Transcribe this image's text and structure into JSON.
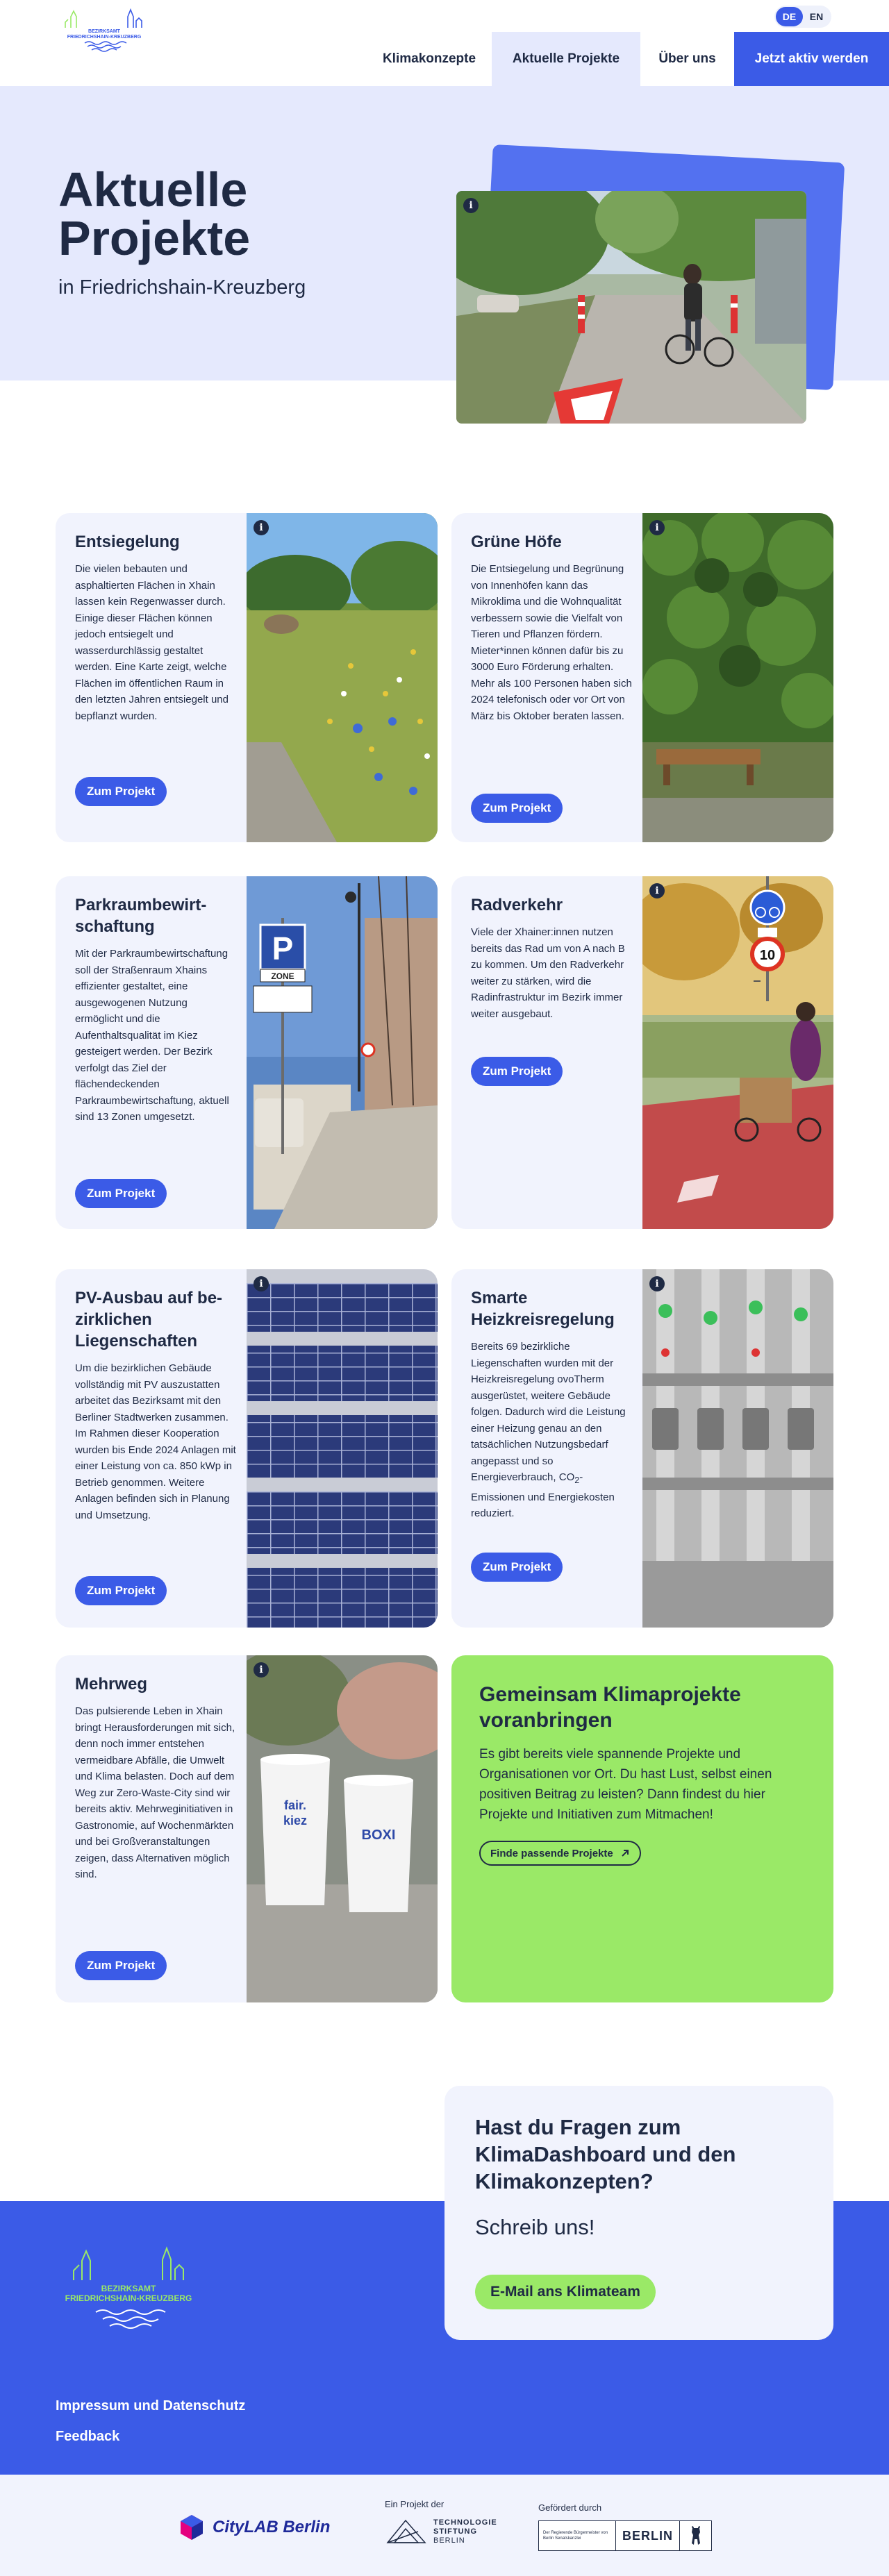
{
  "header": {
    "logo_line1": "BEZIRKSAMT",
    "logo_line2": "FRIEDRICHSHAIN-KREUZBERG",
    "lang": {
      "de": "DE",
      "en": "EN"
    },
    "nav": {
      "klimakonzepte": "Klimakonzepte",
      "aktuelle_projekte": "Aktuelle Projekte",
      "ueber_uns": "Über uns",
      "aktiv": "Jetzt aktiv werden"
    }
  },
  "hero": {
    "title_line1": "Aktuelle",
    "title_line2": "Projekte",
    "subtitle": "in Friedrichshain-Kreuzberg"
  },
  "info_glyph": "i",
  "projects": [
    {
      "title": "Entsiegelung",
      "description": "Die vielen bebauten und asphaltierten Flächen in Xhain lassen kein Regenwasser durch. Einige dieser Flächen können jedoch entsiegelt und wasserdurchlässig gestaltet werden. Eine Karte zeigt, welche Flächen im öffentlichen Raum in den letzten Jahren entsiegelt und bepflanzt wurden.",
      "button": "Zum Projekt"
    },
    {
      "title": "Grüne Höfe",
      "description": "Die Entsiegelung und Begrünung von Innenhöfen kann das Mikroklima und die Wohnqualität verbessern sowie die Vielfalt von Tieren und Pflanzen fördern. Mieter*innen können dafür bis zu 3000 Euro Förderung erhalten. Mehr als 100 Personen haben sich 2024 telefonisch oder vor Ort von März bis Oktober beraten lassen.",
      "button": "Zum Projekt"
    },
    {
      "title_line1": "Parkraumbewirt-",
      "title_line2": "schaftung",
      "description": "Mit der Parkraumbewirtschaftung soll der Straßenraum Xhains effizienter gestaltet, eine ausgewogenen Nutzung ermöglicht und die Aufenthaltsqualität im Kiez gesteigert werden. Der Bezirk verfolgt das Ziel der flächendeckenden Parkraumbewirtschaftung, aktuell sind 13 Zonen umgesetzt.",
      "button": "Zum Projekt",
      "sign_text": "ZONE"
    },
    {
      "title": "Radverkehr",
      "description": "Viele der Xhainer:innen nutzen bereits das Rad um von A nach B zu kommen. Um den Radverkehr weiter zu stärken, wird die Radinfrastruktur im Bezirk immer weiter ausgebaut.",
      "button": "Zum Projekt",
      "sign_number": "10"
    },
    {
      "title_line1": "PV-Ausbau auf be-",
      "title_line2": "zirklichen",
      "title_line3": "Liegenschaften",
      "description": "Um die bezirklichen Gebäude vollständig mit PV auszustatten arbeitet das Bezirksamt mit den Berliner Stadtwerken zusammen. Im Rahmen dieser Kooperation wurden bis Ende 2024 Anlagen mit einer Leistung von ca. 850 kWp in Betrieb genommen. Weitere Anlagen befinden sich in Planung und Umsetzung.",
      "button": "Zum Projekt"
    },
    {
      "title_line1": "Smarte",
      "title_line2": "Heizkreisregelung",
      "description_part1": "Bereits 69 bezirkliche Liegenschaften wurden mit der Heizkreisregelung ovoTherm ausgerüstet, weitere Gebäude folgen. Dadurch wird die Leistung einer Heizung genau an den tatsächlichen Nutzungsbedarf angepasst und so Energieverbrauch, CO",
      "description_sub": "2",
      "description_part2": "-Emissionen und Energiekosten reduziert.",
      "button": "Zum Projekt"
    },
    {
      "title": "Mehrweg",
      "description": "Das pulsierende Leben in Xhain bringt Herausforderungen mit sich, denn noch immer entstehen vermeidbare Abfälle, die Umwelt und Klima belasten. Doch auf dem Weg zur Zero-Waste-City sind wir bereits aktiv. Mehrweginitiativen in Gastronomie, auf Wochenmärkten und bei Großveranstaltungen zeigen, dass Alternativen möglich sind.",
      "button": "Zum Projekt",
      "cup1_line1": "fair.",
      "cup1_line2": "kiez",
      "cup2_text": "BOXI"
    }
  ],
  "cta": {
    "title": "Gemeinsam Klimaprojekte voranbringen",
    "text": "Es gibt bereits viele spannende Projekte und Organisationen vor Ort. Du hast Lust, selbst einen positiven Beitrag zu leisten? Dann findest du hier Projekte und Initiativen zum Mitmachen!",
    "button": "Finde passende Projekte"
  },
  "contact": {
    "title": "Hast du Fragen zum KlimaDashboard und den Klimakonzepten?",
    "subtitle": "Schreib uns!",
    "button": "E-Mail ans Klimateam"
  },
  "footer": {
    "logo_line1": "BEZIRKSAMT",
    "logo_line2": "FRIEDRICHSHAIN-KREUZBERG",
    "impressum": "Impressum und Datenschutz",
    "feedback": "Feedback"
  },
  "sponsors": {
    "citylab": "CityLAB Berlin",
    "projekt_der": "Ein Projekt der",
    "tsb_line1": "TECHNOLOGIE",
    "tsb_line2": "STIFTUNG",
    "tsb_line3": "BERLIN",
    "gefoerdert": "Gefördert durch",
    "berlin_small": "Der Regierende Bürgermeister von Berlin Senatskanzlei",
    "berlin": "BERLIN"
  },
  "colors": {
    "primary_blue": "#3b5be7",
    "light_blue_bg": "#e5e9fd",
    "card_bg": "#f1f3fd",
    "green": "#9ae967",
    "navy_text": "#1f2a44"
  },
  "icons": [
    "info-icon",
    "arrow-up-right-icon",
    "bezirksamt-logo",
    "citylab-logo",
    "tsb-logo",
    "berlin-bear-logo"
  ]
}
